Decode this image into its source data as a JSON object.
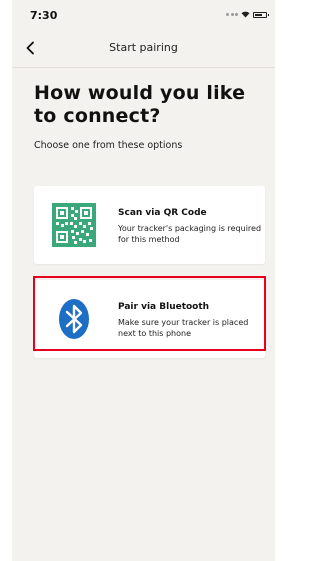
{
  "status_bar": {
    "time": "7:30"
  },
  "nav": {
    "title": "Start pairing",
    "back_icon": "chevron-left-icon"
  },
  "main": {
    "heading": "How would you like to connect?",
    "subheading": "Choose one from these options",
    "options": [
      {
        "title": "Scan via QR Code",
        "description": "Your tracker's packaging is required for this method",
        "icon": "qr-code-icon",
        "icon_color": "#3aa87a"
      },
      {
        "title": "Pair via Bluetooth",
        "description": "Make sure your tracker is placed next to this phone",
        "icon": "bluetooth-icon",
        "icon_color": "#1c6fc4"
      }
    ]
  },
  "colors": {
    "background": "#f4f2ef",
    "highlight": "#e8001c"
  }
}
